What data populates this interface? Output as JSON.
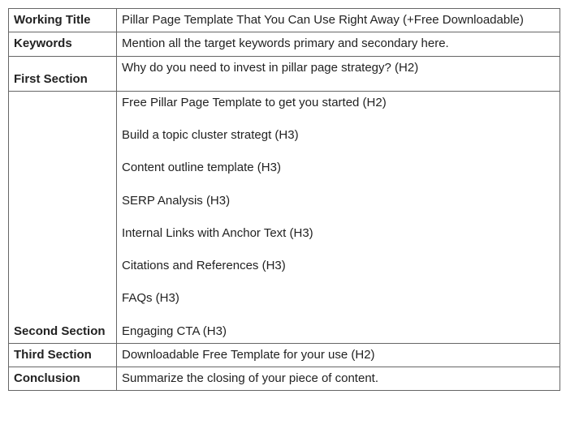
{
  "rows": [
    {
      "label": "Working Title",
      "content": [
        "Pillar Page Template That You Can Use Right Away (+Free Downloadable)"
      ]
    },
    {
      "label": "Keywords",
      "content": [
        "Mention all the target keywords primary and secondary here."
      ]
    },
    {
      "label": "First Section",
      "content": [
        "Why do you need to invest in pillar page strategy? (H2)"
      ]
    },
    {
      "label": "Second Section",
      "content": [
        "Free Pillar Page Template to get you started (H2)",
        "Build a topic cluster strategt (H3)",
        "Content outline template (H3)",
        "SERP Analysis (H3)",
        "Internal Links with Anchor Text (H3)",
        "Citations and References (H3)",
        "FAQs (H3)",
        "Engaging CTA (H3)"
      ]
    },
    {
      "label": "Third Section",
      "content": [
        "Downloadable Free Template for your use (H2)"
      ]
    },
    {
      "label": "Conclusion",
      "content": [
        "Summarize the closing of your piece of content."
      ]
    }
  ]
}
